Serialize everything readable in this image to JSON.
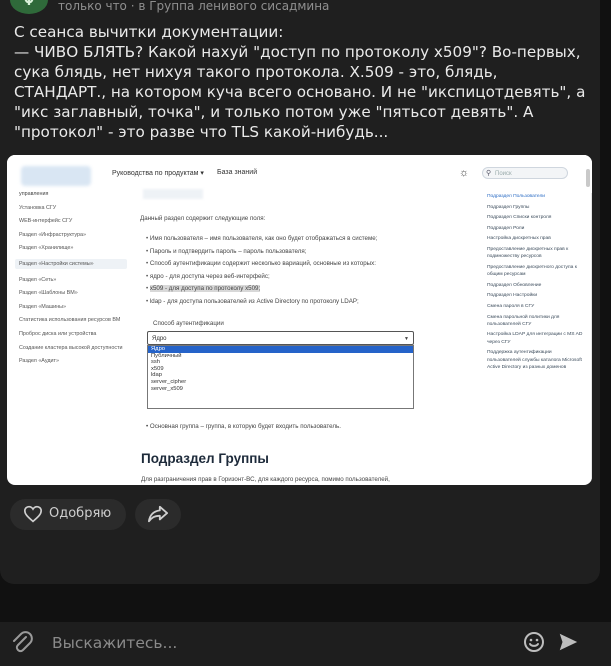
{
  "post": {
    "avatar_text": "Ψ",
    "meta": "только что · в Группа ленивого сисадмина",
    "text_lines": [
      "С сеанса вычитки документации:",
      "— ЧИВО БЛЯТЬ? Какой нахуй \"доступ по протоколу x509\"? Во-первых, сука блядь, нет нихуя такого протокола. X.509 - это, блядь, СТАНДАРТ., на котором куча всего основано. И не \"икспицотдевять\", а \"икс заглавный, точка\", и только потом уже \"пятьсот девять\". А \"протокол\" - это разве что TLS какой-нибудь..."
    ]
  },
  "screenshot": {
    "nav": [
      "Руководства по продуктам ▾",
      "База знаний"
    ],
    "search_placeholder": "Поиск",
    "sidebar": [
      "управления",
      "Установка СГУ",
      "WEB-интерфейс СГУ",
      "Раздел «Инфраструктура»",
      "Раздел «Хранилище»",
      "Раздел «Настройки системы»",
      "Раздел «Сеть»",
      "Раздел «Шаблоны ВМ»",
      "Раздел «Машины»",
      "Статистика использования ресурсов ВМ",
      "Проброс диска или устройства",
      "Создание кластера высокой доступности",
      "Раздел «Аудит»"
    ],
    "active_sidebar_index": 5,
    "intro": "Данный раздел содержит следующие поля:",
    "bullets": [
      "Имя пользователя – имя пользователя, как оно будет отображаться в системе;",
      "Пароль и подтвердить пароль – пароль пользователя;",
      "Способ аутентификации содержит несколько вариаций, основные из которых:",
      "ядро - для доступа через веб-интерфейс;",
      "x509 - для доступа по протоколу x509;",
      "ldap - для доступа пользователей из Active Directory по протоколу LDAP;"
    ],
    "highlight_index": 4,
    "auth_label": "Способ аутентификации",
    "dropdown_value": "Ядро",
    "dropdown_options": [
      "Ядро",
      "Публичный",
      "ssh",
      "x509",
      "ldap",
      "server_cipher",
      "server_x509"
    ],
    "group_note": "Основная группа – группа, в которую будет входить пользователь.",
    "heading": "Подраздел Группы",
    "last_line": "Для разграничения прав в Горизонт-ВС, для каждого ресурса, помимо пользователей,",
    "toc": [
      "Подраздел Пользователи",
      "Подраздел Группы",
      "Подраздел Списки контроля",
      "Подраздел Роли",
      "Настройка дискретных прав",
      "Предоставление дискретных прав к подмножеству ресурсов",
      "Предоставление дискретного доступа к общим ресурсам",
      "Подраздел Обновление",
      "Подраздел Настройки",
      "Смена пароля в СГУ",
      "Смена парольной политики для пользователей СГУ",
      "Настройка LDAP для интеграции с MS AD через СГУ",
      "Поддержка аутентификации пользователей службы каталога Microsoft Active Directory из разных доменов"
    ]
  },
  "actions": {
    "like_label": "Одобряю"
  },
  "composer": {
    "placeholder": "Выскажитесь..."
  },
  "icons": {
    "like": "heart-icon",
    "share": "share-icon",
    "attach": "paperclip-icon",
    "emoji": "emoji-icon",
    "send": "send-icon"
  },
  "colors": {
    "background": "#111111",
    "card": "#1f1f1f",
    "pill": "#2b2b2b",
    "dropdown_selected": "#2563c9",
    "toc_current": "#2b6cc4"
  }
}
